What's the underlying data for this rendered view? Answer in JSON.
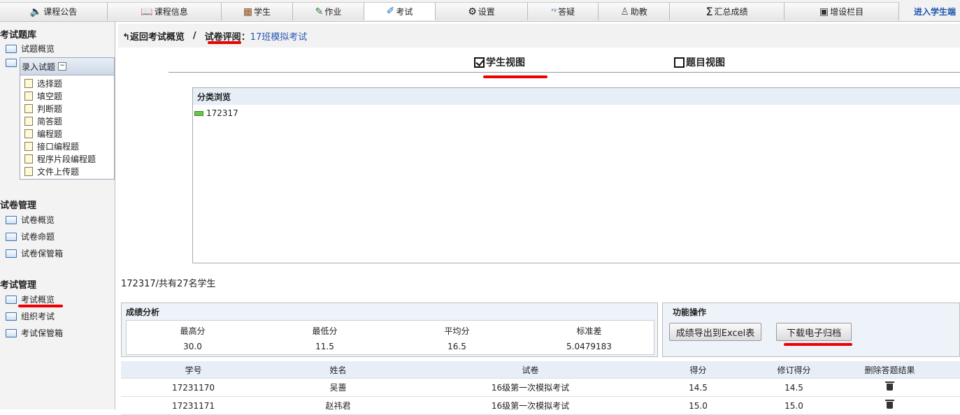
{
  "topnav": {
    "tabs": [
      {
        "label": "课程公告",
        "icon": "speaker-icon",
        "glyph": "🔈",
        "color": "#d9341c"
      },
      {
        "label": "课程信息",
        "icon": "book-icon",
        "glyph": "📖",
        "color": "#444444"
      },
      {
        "label": "学生",
        "icon": "student-icon",
        "glyph": "▦",
        "color": "#8a4b1a"
      },
      {
        "label": "作业",
        "icon": "homework-icon",
        "glyph": "✎",
        "color": "#2e7d32"
      },
      {
        "label": "考试",
        "icon": "exam-icon",
        "glyph": "✐",
        "color": "#1f6fc7"
      },
      {
        "label": "设置",
        "icon": "gear-icon",
        "glyph": "⚙",
        "color": "#111111"
      },
      {
        "label": "答疑",
        "icon": "qa-icon",
        "glyph": "ˣʸ",
        "color": "#1f55b0"
      },
      {
        "label": "助教",
        "icon": "assistant-icon",
        "glyph": "♙",
        "color": "#555555"
      },
      {
        "label": "汇总成绩",
        "icon": "sigma-icon",
        "glyph": "Σ",
        "color": "#111111"
      },
      {
        "label": "增设栏目",
        "icon": "add-column-icon",
        "glyph": "▣",
        "color": "#333333"
      }
    ],
    "active_index": 4,
    "enter_student": "进入学生端"
  },
  "sidebar": {
    "section_bank": "考试题库",
    "bank_overview": "试题概览",
    "entry": {
      "title": "录入试题",
      "items": [
        "选择题",
        "填空题",
        "判断题",
        "简答题",
        "编程题",
        "接口编程题",
        "程序片段编程题",
        "文件上传题"
      ]
    },
    "section_paper": "试卷管理",
    "paper_items": [
      "试卷概览",
      "试卷命题",
      "试卷保管箱"
    ],
    "section_exam": "考试管理",
    "exam_items": [
      "考试概览",
      "组织考试",
      "考试保管箱"
    ]
  },
  "breadcrumb": {
    "back": "返回考试概览",
    "sep": "/",
    "current": "试卷评阅",
    "colon": "：",
    "exam_name": "17班模拟考试"
  },
  "views": {
    "student_view": "学生视图",
    "question_view": "题目视图"
  },
  "browse": {
    "title": "分类浏览",
    "node": "172317"
  },
  "count_text": "172317/共有27名学生",
  "stats": {
    "title": "成绩分析",
    "cols": [
      {
        "label": "最高分",
        "value": "30.0"
      },
      {
        "label": "最低分",
        "value": "11.5"
      },
      {
        "label": "平均分",
        "value": "16.5"
      },
      {
        "label": "标准差",
        "value": "5.0479183"
      }
    ]
  },
  "functions": {
    "title": "功能操作",
    "export_excel": "成绩导出到Excel表",
    "download_archive": "下载电子归档"
  },
  "table": {
    "headers": [
      "学号",
      "姓名",
      "试卷",
      "得分",
      "修订得分",
      "删除答题结果"
    ],
    "rows": [
      [
        "17231170",
        "吴蔷",
        "16级第一次模拟考试",
        "14.5",
        "14.5"
      ],
      [
        "17231171",
        "赵祎君",
        "16级第一次模拟考试",
        "15.0",
        "15.0"
      ]
    ]
  }
}
